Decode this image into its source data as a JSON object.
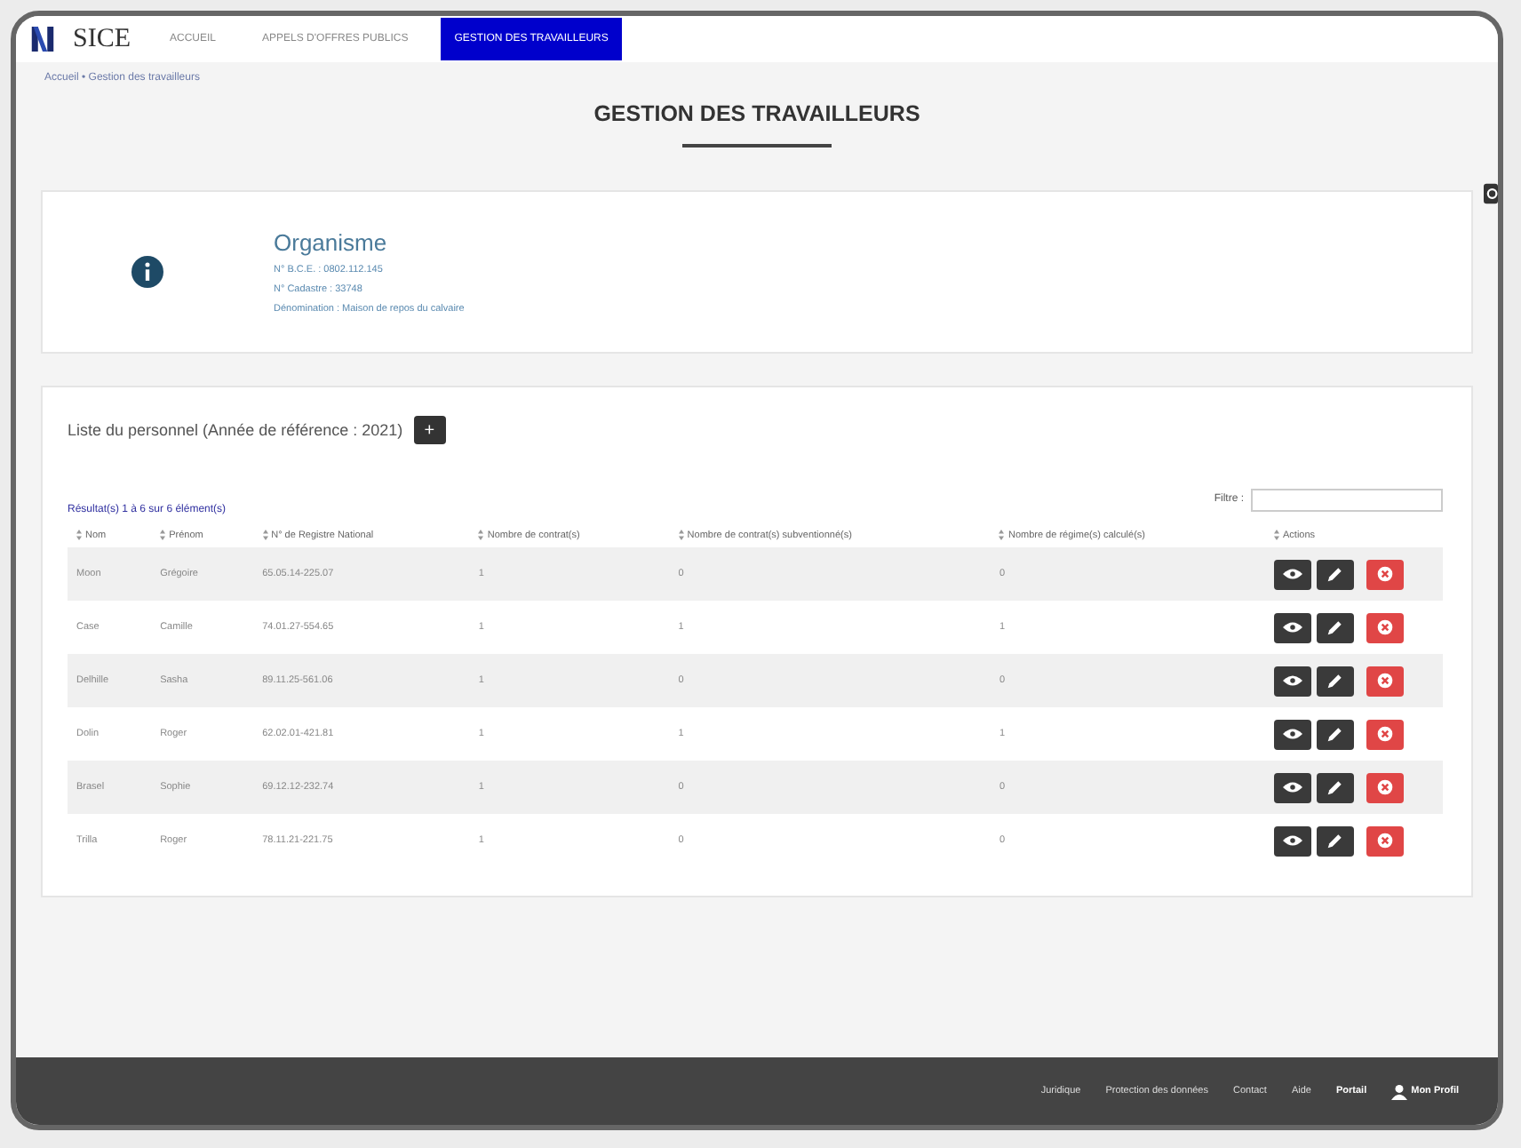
{
  "nav": {
    "brand": "SICE",
    "items": [
      {
        "label": "ACCUEIL",
        "selected": false
      },
      {
        "label": "APPELS D'OFFRES PUBLICS",
        "selected": false
      },
      {
        "label": "GESTION DES TRAVAILLEURS",
        "selected": true
      }
    ]
  },
  "breadcrumb": "Accueil • Gestion des travailleurs",
  "title": "GESTION DES TRAVAILLEURS",
  "organisme": {
    "heading": "Organisme",
    "lines": [
      "N° B.C.E. : 0802.112.145",
      "N° Cadastre : 33748",
      "Dénomination : Maison de repos du calvaire"
    ]
  },
  "personnel": {
    "heading": "Liste du personnel (Année de référence : 2021)",
    "add_button": "+",
    "results": "Résultat(s) 1 à 6 sur 6 élément(s)",
    "filter_label": "Filtre :",
    "columns": [
      "Nom",
      "Prénom",
      "N° de Registre National",
      "Nombre de contrat(s)",
      "Nombre de contrat(s) subventionné(s)",
      "Nombre de régime(s) calculé(s)",
      "Actions"
    ],
    "rows": [
      {
        "cells": [
          "Moon",
          "Grégoire",
          "65.05.14-225.07",
          "1",
          "0",
          "0"
        ]
      },
      {
        "cells": [
          "Case",
          "Camille",
          "74.01.27-554.65",
          "1",
          "1",
          "1"
        ]
      },
      {
        "cells": [
          "Delhille",
          "Sasha",
          "89.11.25-561.06",
          "1",
          "0",
          "0"
        ]
      },
      {
        "cells": [
          "Dolin",
          "Roger",
          "62.02.01-421.81",
          "1",
          "1",
          "1"
        ]
      },
      {
        "cells": [
          "Brasel",
          "Sophie",
          "69.12.12-232.74",
          "1",
          "0",
          "0"
        ]
      },
      {
        "cells": [
          "Trilla",
          "Roger",
          "78.11.21-221.75",
          "1",
          "0",
          "0"
        ]
      }
    ]
  },
  "footer": {
    "links": [
      "Juridique",
      "Protection des données",
      "Contact",
      "Aide",
      "Portail"
    ],
    "user": "Mon Profil"
  }
}
